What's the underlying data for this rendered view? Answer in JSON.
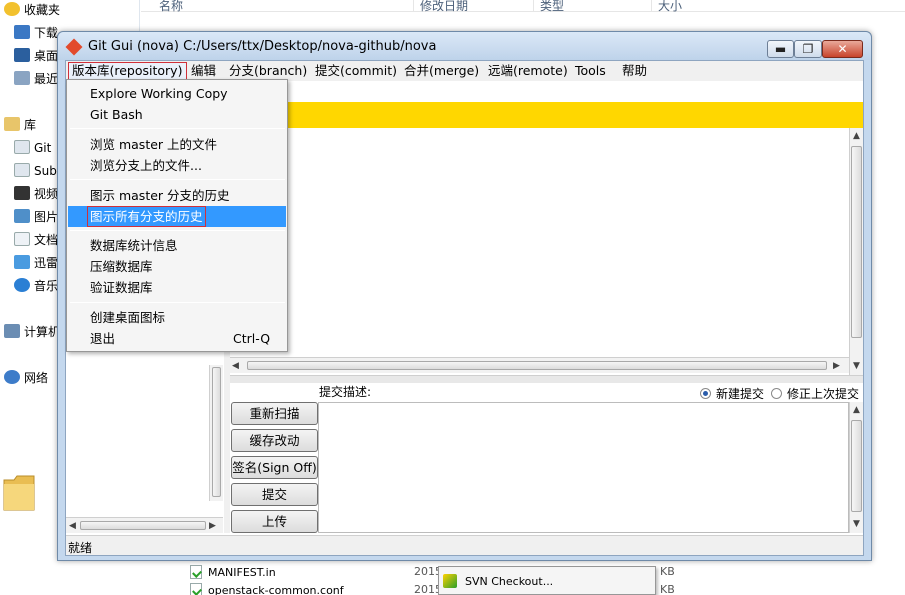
{
  "explorer": {
    "nav": [
      {
        "label": "收藏夹",
        "icon": "star-icon",
        "level": "top"
      },
      {
        "label": "下载",
        "icon": "downloads-icon",
        "level": "child"
      },
      {
        "label": "桌面",
        "icon": "desktop-icon",
        "level": "child"
      },
      {
        "label": "最近",
        "icon": "recent-places-icon",
        "level": "child"
      },
      {
        "label": "库",
        "icon": "libraries-icon",
        "level": "top"
      },
      {
        "label": "Git",
        "icon": "git-library-icon",
        "level": "child"
      },
      {
        "label": "Subv",
        "icon": "subversion-library-icon",
        "level": "child"
      },
      {
        "label": "视频",
        "icon": "videos-icon",
        "level": "child"
      },
      {
        "label": "图片",
        "icon": "pictures-icon",
        "level": "child"
      },
      {
        "label": "文档",
        "icon": "documents-icon",
        "level": "child"
      },
      {
        "label": "迅雷",
        "icon": "thunder-download-icon",
        "level": "child"
      },
      {
        "label": "音乐",
        "icon": "music-icon",
        "level": "child"
      },
      {
        "label": "计算机",
        "icon": "computer-icon",
        "level": "top"
      },
      {
        "label": "网络",
        "icon": "network-icon",
        "level": "top"
      }
    ],
    "columns": [
      "名称",
      "修改日期",
      "类型",
      "大小"
    ],
    "files": [
      {
        "name": "MANIFEST.in",
        "date": "2015",
        "size": "KB"
      },
      {
        "name": "openstack-common.conf",
        "date": "2015",
        "size": "KB"
      }
    ],
    "context_menu": {
      "item": "SVN Checkout..."
    }
  },
  "git_gui": {
    "title": "Git Gui (nova) C:/Users/ttx/Desktop/nova-github/nova",
    "menubar": [
      {
        "key": "repository",
        "label": "版本库(repository)"
      },
      {
        "key": "edit",
        "label": "编辑"
      },
      {
        "key": "branch",
        "label": "分支(branch)"
      },
      {
        "key": "commit",
        "label": "提交(commit)"
      },
      {
        "key": "merge",
        "label": "合并(merge)"
      },
      {
        "key": "remote",
        "label": "远端(remote)"
      },
      {
        "key": "tools",
        "label": "Tools"
      },
      {
        "key": "help",
        "label": "帮助"
      }
    ],
    "window_buttons": {
      "minimize": "▬",
      "maximize": "❐",
      "close": "✕"
    },
    "commit_area": {
      "label": "提交描述:",
      "new_commit": "新建提交",
      "amend_commit": "修正上次提交",
      "selected": "new_commit"
    },
    "buttons": {
      "rescan": "重新扫描",
      "stage_changed": "缓存改动",
      "sign_off": "签名(Sign Off)",
      "commit": "提交",
      "push": "上传"
    },
    "status": "就绪",
    "colors": {
      "diff_header": "#ffd700",
      "highlight": "#3399ff",
      "annotation_box": "#d0303a"
    }
  },
  "repo_menu": {
    "items": [
      {
        "label": "Explore Working Copy"
      },
      {
        "label": "Git Bash"
      },
      {
        "separator": true
      },
      {
        "label": "浏览 master 上的文件"
      },
      {
        "label": "浏览分支上的文件..."
      },
      {
        "separator": true
      },
      {
        "label": "图示 master 分支的历史"
      },
      {
        "label": "图示所有分支的历史",
        "highlighted": true
      },
      {
        "separator": true
      },
      {
        "label": "数据库统计信息"
      },
      {
        "label": "压缩数据库"
      },
      {
        "label": "验证数据库"
      },
      {
        "separator": true
      },
      {
        "label": "创建桌面图标"
      },
      {
        "label": "退出",
        "shortcut": "Ctrl-Q"
      }
    ]
  }
}
